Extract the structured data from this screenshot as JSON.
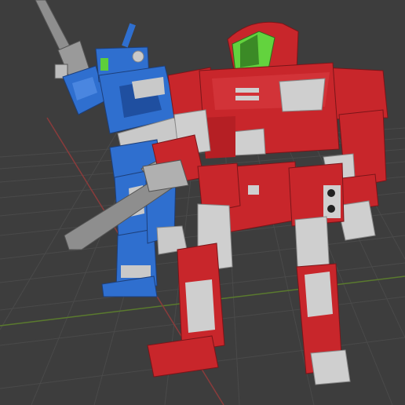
{
  "viewport": {
    "background": "#3d3d3d",
    "grid_color": "#4a4a4a",
    "x_axis_color": "#8a3b3b",
    "y_axis_color": "#5a7a2e"
  },
  "scene": {
    "objects": [
      {
        "name": "blue-mecha",
        "primary_color": "#2f6fcf",
        "secondary_color": "#c9c9c9",
        "weapon_color": "#8e8e8e",
        "visor_color": "#5dcf3a"
      },
      {
        "name": "red-mecha",
        "primary_color": "#c8262b",
        "secondary_color": "#cfcfcf",
        "visor_color": "#63d33e"
      }
    ]
  }
}
